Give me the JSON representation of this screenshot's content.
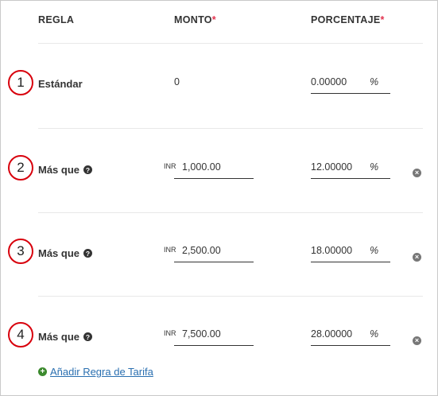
{
  "header": {
    "rule": "REGLA",
    "amount": "MONTO",
    "percentage": "PORCENTAJE",
    "required_mark": "*"
  },
  "rows": [
    {
      "number": "1",
      "label": "Estándar",
      "currency": "",
      "amount": "0",
      "percentage": "0.00000",
      "pct_sign": "%"
    },
    {
      "number": "2",
      "label": "Más que",
      "currency": "INR",
      "amount": "1,000.00",
      "percentage": "12.00000",
      "pct_sign": "%"
    },
    {
      "number": "3",
      "label": "Más que",
      "currency": "INR",
      "amount": "2,500.00",
      "percentage": "18.00000",
      "pct_sign": "%"
    },
    {
      "number": "4",
      "label": "Más que",
      "currency": "INR",
      "amount": "7,500.00",
      "percentage": "28.00000",
      "pct_sign": "%"
    }
  ],
  "icons": {
    "help": "?",
    "remove": "×",
    "add": "+"
  },
  "add_rule": {
    "label": "Añadir Regra de Tarifa"
  },
  "colors": {
    "badge_ring": "#d8000c",
    "required": "#e2334f",
    "link": "#2a6fb0",
    "add_icon": "#3c8a2e"
  }
}
